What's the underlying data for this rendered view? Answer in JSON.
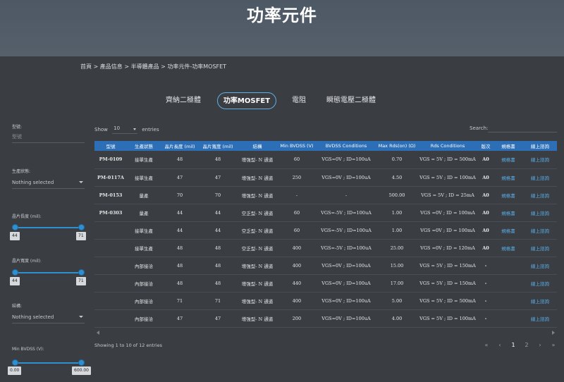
{
  "hero": {
    "title": "功率元件"
  },
  "breadcrumb": "首頁 > 產品信息 > 半導體產品 > 功率元件-功率MOSFET",
  "tabs": [
    {
      "label": "齊納二極體",
      "active": false
    },
    {
      "label": "功率MOSFET",
      "active": true
    },
    {
      "label": "電阻",
      "active": false
    },
    {
      "label": "瞬態電壓二極體",
      "active": false
    }
  ],
  "filters": {
    "model": {
      "label": "型號:",
      "placeholder": "型號"
    },
    "status": {
      "label": "生產狀態:",
      "value": "Nothing selected"
    },
    "length": {
      "label": "晶片長度 (mil):",
      "min": "44",
      "max": "71"
    },
    "width": {
      "label": "晶片寬度 (mil):",
      "min": "44",
      "max": "71"
    },
    "structure": {
      "label": "結構:",
      "value": "Nothing selected"
    },
    "bvdss": {
      "label": "Min BVDSS (V):",
      "min": "0.00",
      "max": "600.00"
    }
  },
  "table_controls": {
    "show_label": "Show",
    "length_value": "10",
    "entries_label": "entries",
    "search_label": "Search:"
  },
  "table": {
    "headers": [
      "型號",
      "生產狀態",
      "晶片長度 (mil)",
      "晶片寬度 (mil)",
      "結構",
      "Min BVDSS (V)",
      "BVDSS Conditions",
      "Max Rds(on) (Ω)",
      "Rds Conditions",
      "版次",
      "規格書",
      "線上諮詢"
    ],
    "rows": [
      [
        "PM-0109",
        "接單生產",
        "48",
        "48",
        "增強型- N 通道",
        "60",
        "VGS=0V ; ID=100uA",
        "0.70",
        "VGS = 5V ; ID = 500mA",
        "A0",
        "規格書",
        "線上諮詢"
      ],
      [
        "PM-0117A",
        "接單生產",
        "47",
        "47",
        "增強型- N 通道",
        "250",
        "VGS=0V ; ID=100uA",
        "4.50",
        "VGS = 5V ; ID = 100mA",
        "A0",
        "規格書",
        "線上諮詢"
      ],
      [
        "PM-0153",
        "量產",
        "70",
        "70",
        "增強型- N 通道",
        "-",
        "-",
        "500.00",
        "VGS = 5V ; ID = 25mA",
        "A0",
        "規格書",
        "線上諮詢"
      ],
      [
        "PM-0303",
        "量產",
        "44",
        "44",
        "空乏型- N 通道",
        "60",
        "VGS=-5V ; ID=100uA",
        "1.00",
        "VGS =0V ; ID = 100mA",
        "A0",
        "規格書",
        "線上諮詢"
      ],
      [
        "",
        "接單生產",
        "44",
        "44",
        "空乏型- N 通道",
        "60",
        "VGS=-5V ; ID=100uA",
        "1.00",
        "VGS =0V ; ID = 100mA",
        "A0",
        "規格書",
        "線上諮詢"
      ],
      [
        "",
        "接單生產",
        "48",
        "48",
        "空乏型- N 通道",
        "400",
        "VGS=-5V ; ID=100uA",
        "25.00",
        "VGS =0V ; ID = 120mA",
        "A0",
        "規格書",
        "線上諮詢"
      ],
      [
        "",
        "內部接洽",
        "48",
        "48",
        "增強型- N 通道",
        "400",
        "VGS=0V ; ID=100uA",
        "15.00",
        "VGS = 5V ; ID = 150mA",
        "-",
        "",
        "線上諮詢"
      ],
      [
        "",
        "內部接洽",
        "48",
        "48",
        "增強型- N 通道",
        "440",
        "VGS=0V ; ID=100uA",
        "17.00",
        "VGS = 5V ; ID = 150mA",
        "-",
        "",
        "線上諮詢"
      ],
      [
        "",
        "內部接洽",
        "71",
        "71",
        "增強型- N 通道",
        "400",
        "VGS=0V ; ID=100uA",
        "5.00",
        "VGS = 5V ; ID = 500mA",
        "-",
        "",
        "線上諮詢"
      ],
      [
        "",
        "內部接洽",
        "47",
        "47",
        "增強型- N 通道",
        "200",
        "VGS=0V ; ID=100uA",
        "4.00",
        "VGS = 5V ; ID = 100mA",
        "-",
        "",
        "線上諮詢"
      ]
    ]
  },
  "info": "Showing 1 to 10 of 12 entries",
  "pagination": {
    "first": "«",
    "prev": "‹",
    "pages": [
      "1",
      "2"
    ],
    "current": "1",
    "next": "›",
    "last": "»"
  }
}
